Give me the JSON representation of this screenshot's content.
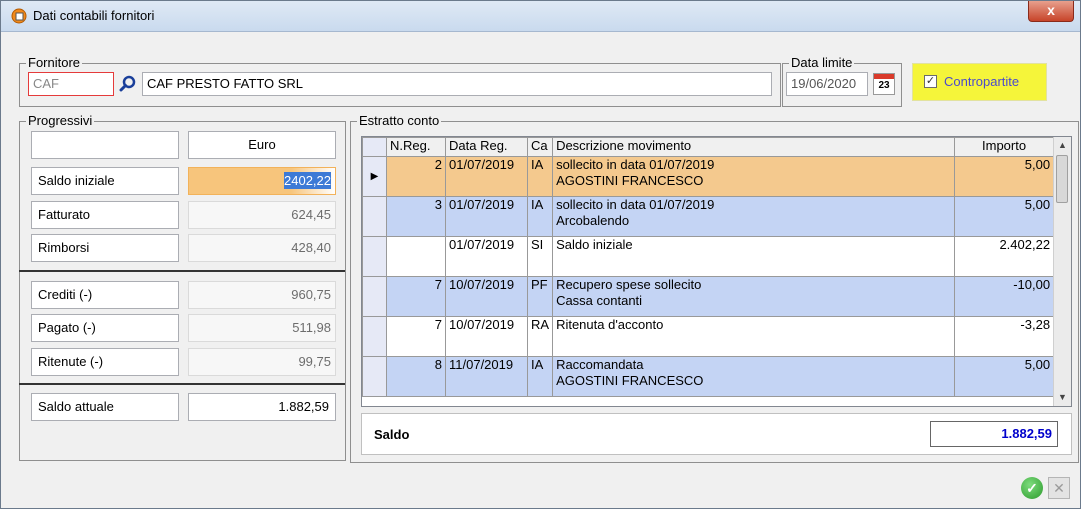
{
  "window": {
    "title": "Dati contabili fornitori",
    "close_label": "x"
  },
  "fornitore": {
    "label": "Fornitore",
    "code": "CAF",
    "name": "CAF PRESTO FATTO SRL"
  },
  "data_limite": {
    "label": "Data limite",
    "value": "19/06/2020",
    "calendar_day": "23"
  },
  "contropartite": {
    "label": "Contropartite",
    "checked": true
  },
  "progressivi": {
    "label": "Progressivi",
    "currency_header": "Euro",
    "rows": [
      {
        "label": "Saldo iniziale",
        "value": "2402,22"
      },
      {
        "label": "Fatturato",
        "value": "624,45"
      },
      {
        "label": "Rimborsi",
        "value": "428,40"
      },
      {
        "label": "Crediti (-)",
        "value": "960,75"
      },
      {
        "label": "Pagato  (-)",
        "value": "511,98"
      },
      {
        "label": "Ritenute (-)",
        "value": "99,75"
      }
    ],
    "saldo_attuale": {
      "label": "Saldo attuale",
      "value": "1.882,59"
    }
  },
  "estratto": {
    "label": "Estratto conto",
    "columns": [
      "N.Reg.",
      "Data Reg.",
      "Ca",
      "Descrizione movimento",
      "Importo"
    ],
    "rows": [
      {
        "nreg": "2",
        "data": "01/07/2019",
        "ca": "IA",
        "desc1": "sollecito in data 01/07/2019",
        "desc2": "AGOSTINI FRANCESCO",
        "importo": "5,00"
      },
      {
        "nreg": "3",
        "data": "01/07/2019",
        "ca": "IA",
        "desc1": "sollecito in data 01/07/2019",
        "desc2": "Arcobalendo",
        "importo": "5,00"
      },
      {
        "nreg": "",
        "data": "01/07/2019",
        "ca": "SI",
        "desc1": "Saldo iniziale",
        "desc2": "",
        "importo": "2.402,22"
      },
      {
        "nreg": "7",
        "data": "10/07/2019",
        "ca": "PF",
        "desc1": "Recupero spese sollecito",
        "desc2": "Cassa contanti",
        "importo": "-10,00"
      },
      {
        "nreg": "7",
        "data": "10/07/2019",
        "ca": "RA",
        "desc1": "Ritenuta d'acconto",
        "desc2": "",
        "importo": "-3,28"
      },
      {
        "nreg": "8",
        "data": "11/07/2019",
        "ca": "IA",
        "desc1": "Raccomandata",
        "desc2": "AGOSTINI FRANCESCO",
        "importo": "5,00"
      }
    ],
    "saldo_label": "Saldo",
    "saldo_value": "1.882,59"
  },
  "colors": {
    "highlight_yellow": "#f5f53a",
    "selected_row": "#f4c98e",
    "blue_row": "#c4d4f4",
    "saldo_blue": "#0000cc"
  }
}
